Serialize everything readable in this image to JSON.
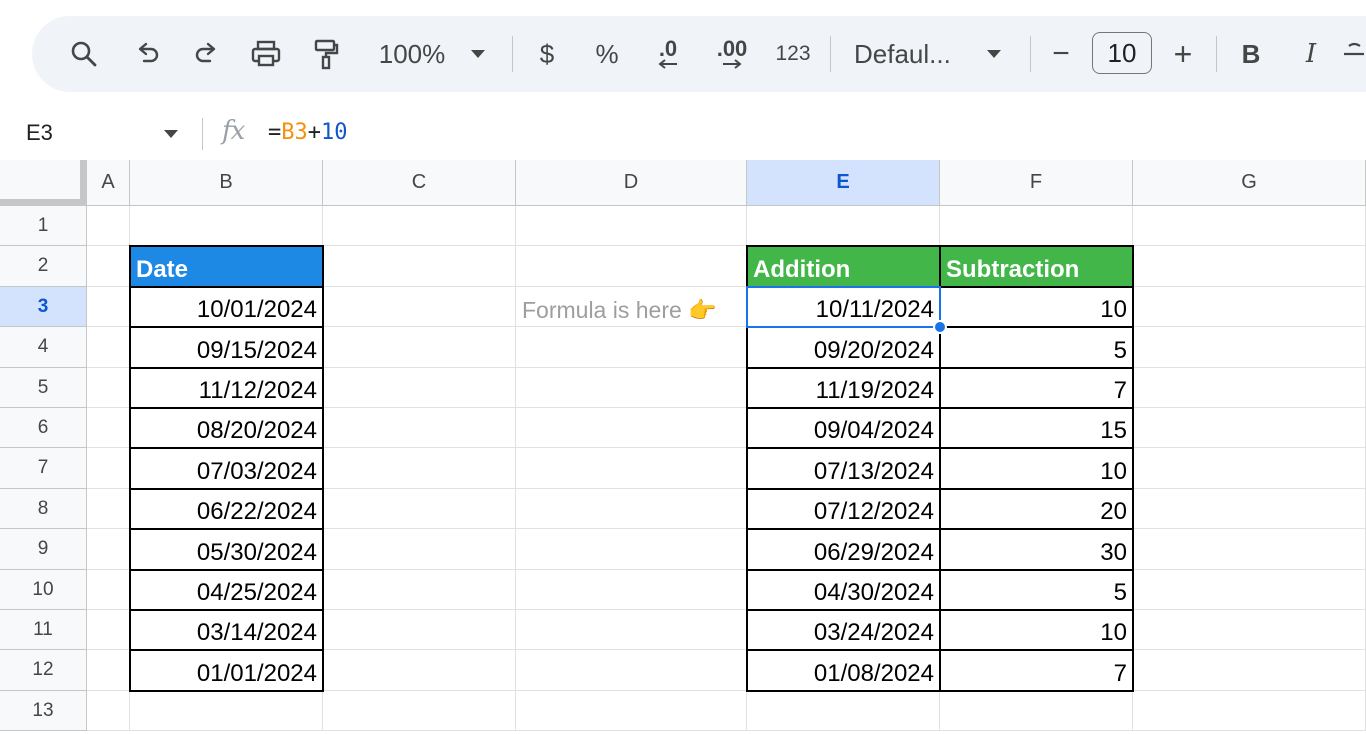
{
  "toolbar": {
    "zoom": "100%",
    "currency": "$",
    "percent": "%",
    "decimal_decrease": ".0",
    "decimal_increase": ".00",
    "number_format": "123",
    "font": "Defaul...",
    "font_size": "10",
    "minus": "−",
    "plus": "+",
    "bold": "B",
    "italic": "I"
  },
  "formula_bar": {
    "cell_ref": "E3",
    "fx": "fx",
    "formula_eq": "=",
    "formula_ref": "B3",
    "formula_op": "+",
    "formula_num": "10"
  },
  "columns": [
    "A",
    "B",
    "C",
    "D",
    "E",
    "F",
    "G"
  ],
  "rows": [
    "1",
    "2",
    "3",
    "4",
    "5",
    "6",
    "7",
    "8",
    "9",
    "10",
    "11",
    "12",
    "13"
  ],
  "table_date": {
    "header": "Date",
    "values": [
      "10/01/2024",
      "09/15/2024",
      "11/12/2024",
      "08/20/2024",
      "07/03/2024",
      "06/22/2024",
      "05/30/2024",
      "04/25/2024",
      "03/14/2024",
      "01/01/2024"
    ]
  },
  "note": "Formula is here 👉",
  "table_calc": {
    "addition_header": "Addition",
    "subtraction_header": "Subtraction",
    "addition": [
      "10/11/2024",
      "09/20/2024",
      "11/19/2024",
      "09/04/2024",
      "07/13/2024",
      "07/12/2024",
      "06/29/2024",
      "04/30/2024",
      "03/24/2024",
      "01/08/2024"
    ],
    "subtraction": [
      "10",
      "5",
      "7",
      "15",
      "10",
      "20",
      "30",
      "5",
      "10",
      "7"
    ]
  },
  "colors": {
    "date_header": "#1e88e5",
    "calc_header": "#43b649",
    "selection": "#1a73e8"
  }
}
